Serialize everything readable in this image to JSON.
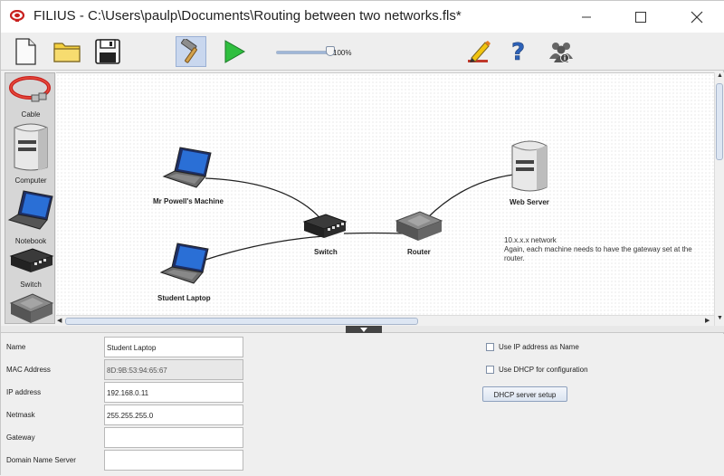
{
  "window": {
    "title": "FILIUS - C:\\Users\\paulp\\Documents\\Routing between two networks.fls*",
    "controls": [
      "minimize",
      "maximize",
      "close"
    ]
  },
  "toolbar": {
    "buttons": [
      {
        "icon": "new-file-icon"
      },
      {
        "icon": "open-folder-icon"
      },
      {
        "icon": "save-floppy-icon"
      },
      {
        "icon": "design-mode-hammer-icon",
        "pressed": true
      },
      {
        "icon": "simulation-play-icon"
      },
      {
        "icon": "documentation-pencil-icon"
      },
      {
        "icon": "help-question-icon"
      },
      {
        "icon": "info-people-icon"
      }
    ],
    "zoom_label": "100%",
    "zoom_level": 1.0
  },
  "palette": {
    "items": [
      {
        "label": "Cable",
        "icon": "cable-icon"
      },
      {
        "label": "Computer",
        "icon": "computer-icon"
      },
      {
        "label": "Notebook",
        "icon": "notebook-icon"
      },
      {
        "label": "Switch",
        "icon": "switch-icon"
      },
      {
        "label": "",
        "icon": "router-icon"
      }
    ]
  },
  "canvas": {
    "nodes": {
      "mr_powell": "Mr Powell's Machine",
      "student_laptop": "Student Laptop",
      "switch": "Switch",
      "router": "Router",
      "web_server": "Web Server"
    },
    "note": {
      "line1": "10.x.x.x network",
      "line2": "Again, each machine needs to have the gateway set at the router."
    }
  },
  "properties": {
    "name": {
      "label": "Name",
      "value": "Student Laptop"
    },
    "mac": {
      "label": "MAC Address",
      "value": "8D:9B:53:94:65:67"
    },
    "ip": {
      "label": "IP address",
      "value": "192.168.0.11"
    },
    "netmask": {
      "label": "Netmask",
      "value": "255.255.255.0"
    },
    "gateway": {
      "label": "Gateway",
      "value": ""
    },
    "dns": {
      "label": "Domain Name Server",
      "value": ""
    },
    "use_ip_as_name": {
      "label": "Use IP address as Name",
      "checked": false
    },
    "use_dhcp": {
      "label": "Use DHCP for configuration",
      "checked": false
    },
    "dhcp_button": "DHCP server setup"
  }
}
